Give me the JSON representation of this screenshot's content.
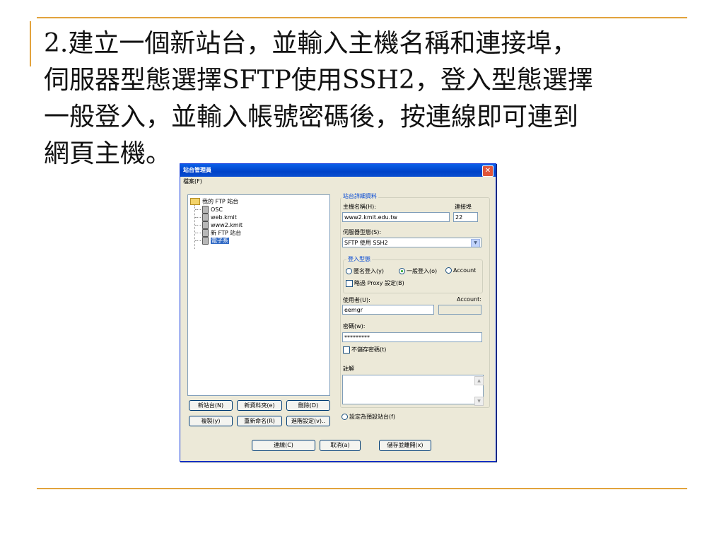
{
  "slide": {
    "lines": [
      "2.建立一個新站台，並輸入主機名稱和連接埠，",
      "伺服器型態選擇SFTP使用SSH2，登入型態選擇",
      "一般登入，並輸入帳號密碼後，按連線即可連到",
      "網頁主機。"
    ]
  },
  "dialog": {
    "title": "站台管理員",
    "close_icon": "close-icon",
    "menu": {
      "file": "檔案(F)"
    },
    "tree": {
      "root": "我的 FTP 站台",
      "items": [
        "OSC",
        "web.kmit",
        "www2.kmit",
        "新 FTP 站台",
        "電子系"
      ],
      "selected": "電子系"
    },
    "left_buttons": {
      "new_site": "新站台(N)",
      "new_folder": "新資料夾(e)",
      "delete": "刪除(D)",
      "copy": "複製(y)",
      "rename": "重新命名(R)",
      "advanced": "進階設定(v).."
    },
    "details": {
      "group_title": "站台詳細資料",
      "host_label": "主機名稱(H):",
      "host_value": "www2.kmit.edu.tw",
      "port_label": "連接埠",
      "port_value": "22",
      "server_type_label": "伺服器型態(S):",
      "server_type_value": "SFTP 使用 SSH2",
      "logon_group": "登入型態",
      "logon_anonymous": "匿名登入(y)",
      "logon_normal": "一般登入(o)",
      "logon_account": "Account",
      "logon_selected": "一般登入(o)",
      "bypass_proxy": "略過 Proxy 設定(B)",
      "user_label": "使用者(U):",
      "user_value": "eemgr",
      "account_label": "Account:",
      "account_value": "",
      "password_label": "密碼(w):",
      "password_value": "*********",
      "dont_save_password": "不儲存密碼(t)",
      "comments_label": "註解",
      "default_site": "設定為預設站台(f)"
    },
    "bottom_buttons": {
      "connect": "連線(C)",
      "cancel": "取消(a)",
      "save_close": "儲存並離開(x)"
    }
  }
}
